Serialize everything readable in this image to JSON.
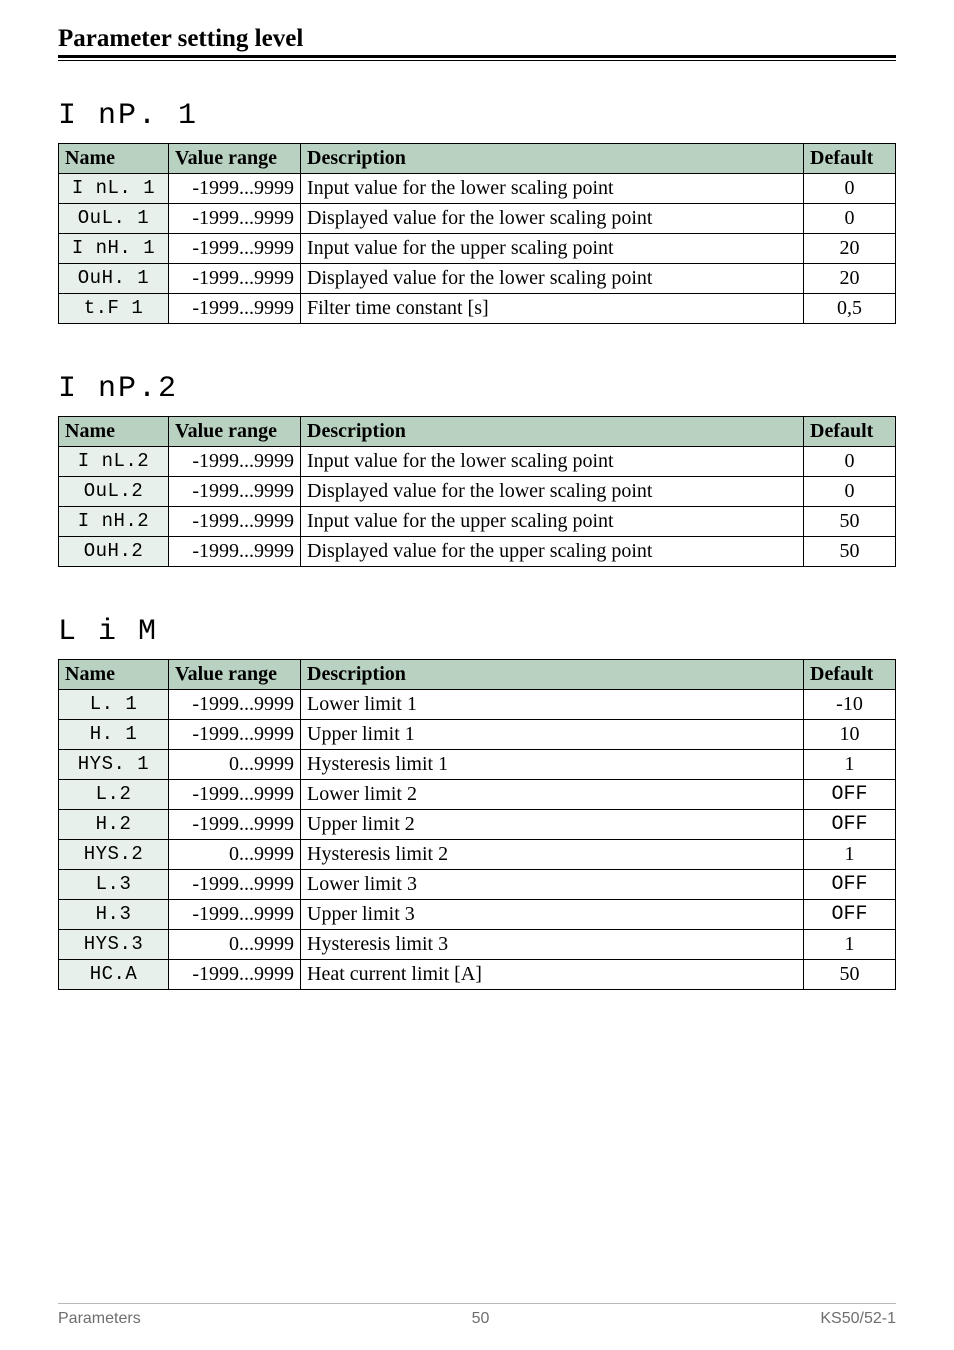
{
  "page": {
    "header_title": "Parameter setting level",
    "footer_left": "Parameters",
    "footer_center": "50",
    "footer_right": "KS50/52-1"
  },
  "columns": {
    "name": "Name",
    "range": "Value range",
    "desc": "Description",
    "def": "Default"
  },
  "sections": [
    {
      "title": "I nP. 1",
      "rows": [
        {
          "name": "I nL. 1",
          "range": "-1999...9999",
          "desc": "Input value for the lower scaling point",
          "def": "0"
        },
        {
          "name": "OuL. 1",
          "range": "-1999...9999",
          "desc": "Displayed value for the lower scaling point",
          "def": "0"
        },
        {
          "name": "I nH. 1",
          "range": "-1999...9999",
          "desc": "Input value for the upper scaling point",
          "def": "20"
        },
        {
          "name": "OuH. 1",
          "range": "-1999...9999",
          "desc": "Displayed value for the lower scaling point",
          "def": "20"
        },
        {
          "name": "t.F 1",
          "range": "-1999...9999",
          "desc": "Filter time constant [s]",
          "def": "0,5"
        }
      ]
    },
    {
      "title": "I nP.2",
      "rows": [
        {
          "name": "I nL.2",
          "range": "-1999...9999",
          "desc": "Input value for the lower scaling point",
          "def": "0"
        },
        {
          "name": "OuL.2",
          "range": "-1999...9999",
          "desc": "Displayed value for the lower scaling point",
          "def": "0"
        },
        {
          "name": "I nH.2",
          "range": "-1999...9999",
          "desc": "Input value for the upper scaling point",
          "def": "50"
        },
        {
          "name": "OuH.2",
          "range": "-1999...9999",
          "desc": "Displayed value for the upper scaling point",
          "def": "50"
        }
      ]
    },
    {
      "title": "L  i M",
      "rows": [
        {
          "name": "L. 1",
          "range": "-1999...9999",
          "desc": "Lower limit 1",
          "def": "-10"
        },
        {
          "name": "H. 1",
          "range": "-1999...9999",
          "desc": "Upper limit 1",
          "def": "10"
        },
        {
          "name": "HYS. 1",
          "range": "0...9999",
          "desc": "Hysteresis limit 1",
          "def": "1"
        },
        {
          "name": "L.2",
          "range": "-1999...9999",
          "desc": "Lower limit 2",
          "def": "OFF",
          "def_seg": true
        },
        {
          "name": "H.2",
          "range": "-1999...9999",
          "desc": "Upper limit 2",
          "def": "OFF",
          "def_seg": true
        },
        {
          "name": "HYS.2",
          "range": "0...9999",
          "desc": "Hysteresis limit 2",
          "def": "1"
        },
        {
          "name": "L.3",
          "range": "-1999...9999",
          "desc": "Lower limit 3",
          "def": "OFF",
          "def_seg": true
        },
        {
          "name": "H.3",
          "range": "-1999...9999",
          "desc": "Upper limit 3",
          "def": "OFF",
          "def_seg": true
        },
        {
          "name": "HYS.3",
          "range": "0...9999",
          "desc": "Hysteresis limit 3",
          "def": "1"
        },
        {
          "name": "HC.A",
          "range": "-1999...9999",
          "desc": "Heat current limit [A]",
          "def": "50"
        }
      ]
    }
  ]
}
